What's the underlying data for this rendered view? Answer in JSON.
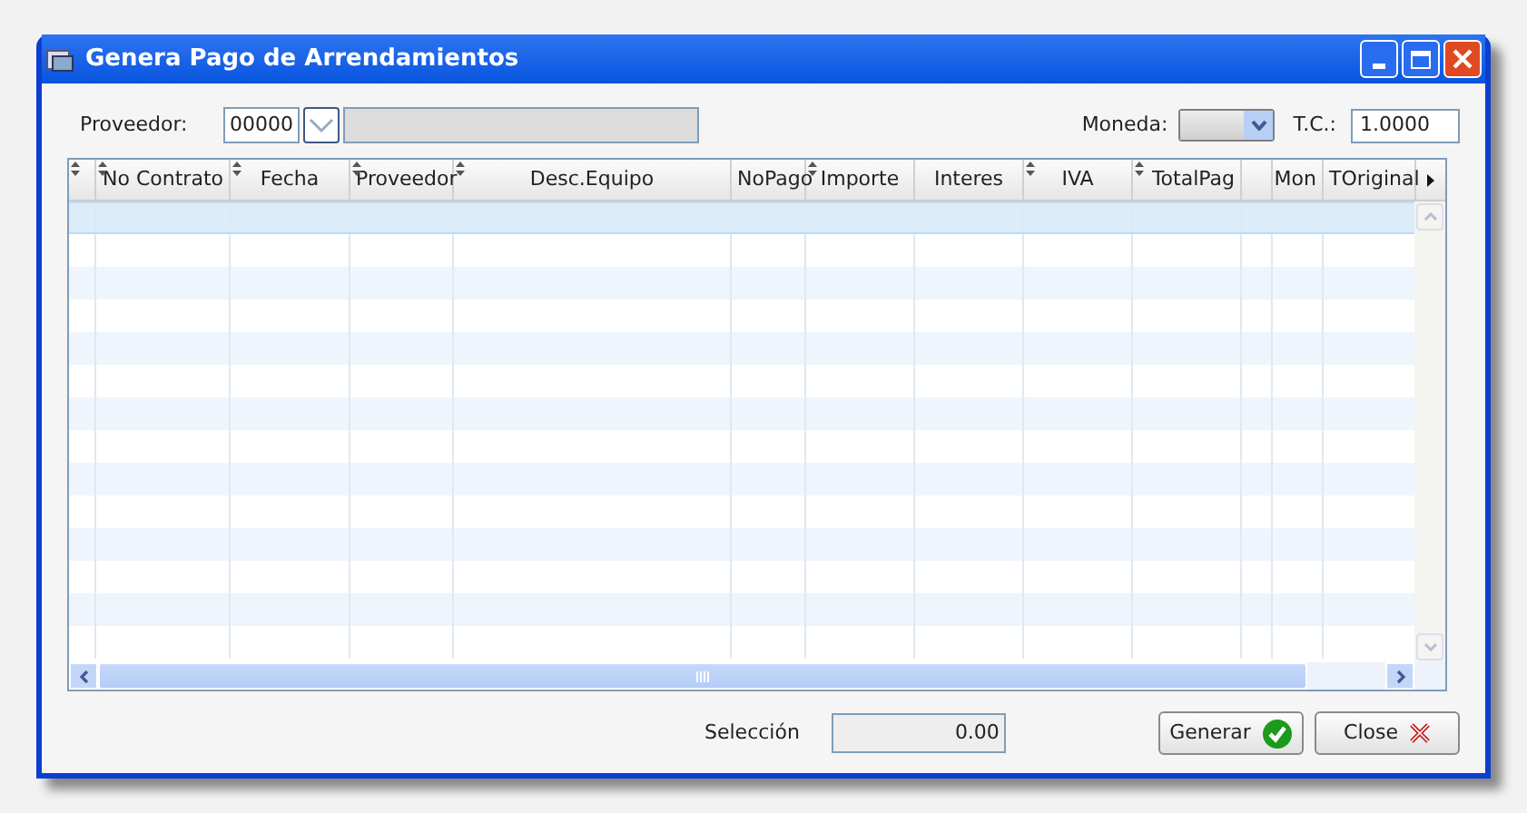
{
  "window": {
    "title": "Genera Pago de Arrendamientos"
  },
  "proveedor": {
    "label": "Proveedor:",
    "code": "00000"
  },
  "moneda": {
    "label": "Moneda:"
  },
  "tc": {
    "label": "T.C.:",
    "value": "1.0000"
  },
  "table": {
    "columns": [
      {
        "sortable": true
      },
      {
        "label": "No Contrato",
        "sortable": true
      },
      {
        "label": "Fecha",
        "sortable": true
      },
      {
        "label": "Proveedor",
        "sortable": true
      },
      {
        "label": "Desc.Equipo",
        "sortable": true
      },
      {
        "label": "NoPago",
        "sortable": false
      },
      {
        "label": "Importe",
        "sortable": true
      },
      {
        "label": "Interes",
        "sortable": false
      },
      {
        "label": "IVA",
        "sortable": true
      },
      {
        "label": "TotalPag",
        "sortable": true
      },
      {
        "sortable": false
      },
      {
        "label": "Mon",
        "sortable": false
      },
      {
        "label": "TOriginal",
        "sortable": false
      }
    ]
  },
  "seleccion": {
    "label": "Selección",
    "value": "0.00"
  },
  "buttons": [
    {
      "label": "Generar",
      "kind": "ok"
    },
    {
      "label": "Close",
      "kind": "close"
    }
  ]
}
